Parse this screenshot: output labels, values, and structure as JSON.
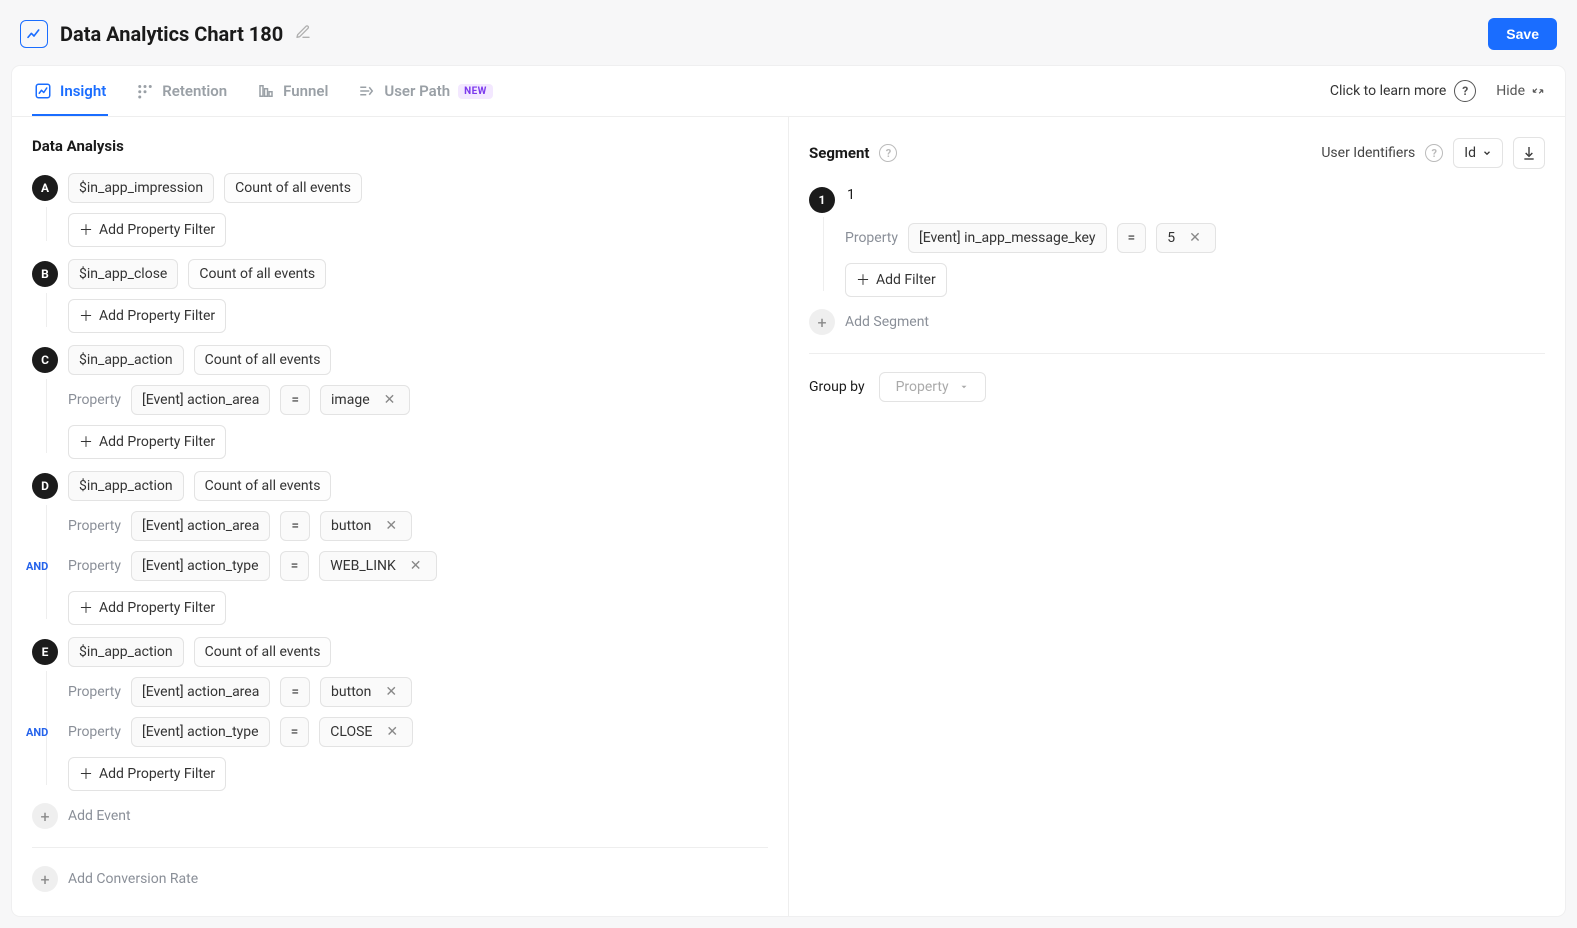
{
  "header": {
    "title": "Data Analytics Chart 180",
    "save_label": "Save"
  },
  "tabs": {
    "insight": "Insight",
    "retention": "Retention",
    "funnel": "Funnel",
    "userpath": "User Path",
    "badge_new": "NEW",
    "learn_more": "Click to learn more",
    "hide": "Hide"
  },
  "analysis": {
    "heading": "Data Analysis",
    "add_property_filter": "Add Property Filter",
    "property_label": "Property",
    "and_label": "AND",
    "add_event": "Add Event",
    "add_conversion_rate": "Add Conversion Rate",
    "events": [
      {
        "letter": "A",
        "name": "$in_app_impression",
        "metric": "Count of all events",
        "filters": []
      },
      {
        "letter": "B",
        "name": "$in_app_close",
        "metric": "Count of all events",
        "filters": []
      },
      {
        "letter": "C",
        "name": "$in_app_action",
        "metric": "Count of all events",
        "filters": [
          {
            "prop": "[Event] action_area",
            "op": "=",
            "val": "image"
          }
        ]
      },
      {
        "letter": "D",
        "name": "$in_app_action",
        "metric": "Count of all events",
        "filters": [
          {
            "prop": "[Event] action_area",
            "op": "=",
            "val": "button"
          },
          {
            "prop": "[Event] action_type",
            "op": "=",
            "val": "WEB_LINK"
          }
        ]
      },
      {
        "letter": "E",
        "name": "$in_app_action",
        "metric": "Count of all events",
        "filters": [
          {
            "prop": "[Event] action_area",
            "op": "=",
            "val": "button"
          },
          {
            "prop": "[Event] action_type",
            "op": "=",
            "val": "CLOSE"
          }
        ]
      }
    ]
  },
  "segment": {
    "heading": "Segment",
    "user_identifiers": "User Identifiers",
    "id_label": "Id",
    "seg1_label": "1",
    "seg1_num": "1",
    "property_label": "Property",
    "filter_prop": "[Event] in_app_message_key",
    "filter_op": "=",
    "filter_val": "5",
    "add_filter": "Add Filter",
    "add_segment": "Add Segment",
    "group_by": "Group by",
    "property_placeholder": "Property"
  }
}
